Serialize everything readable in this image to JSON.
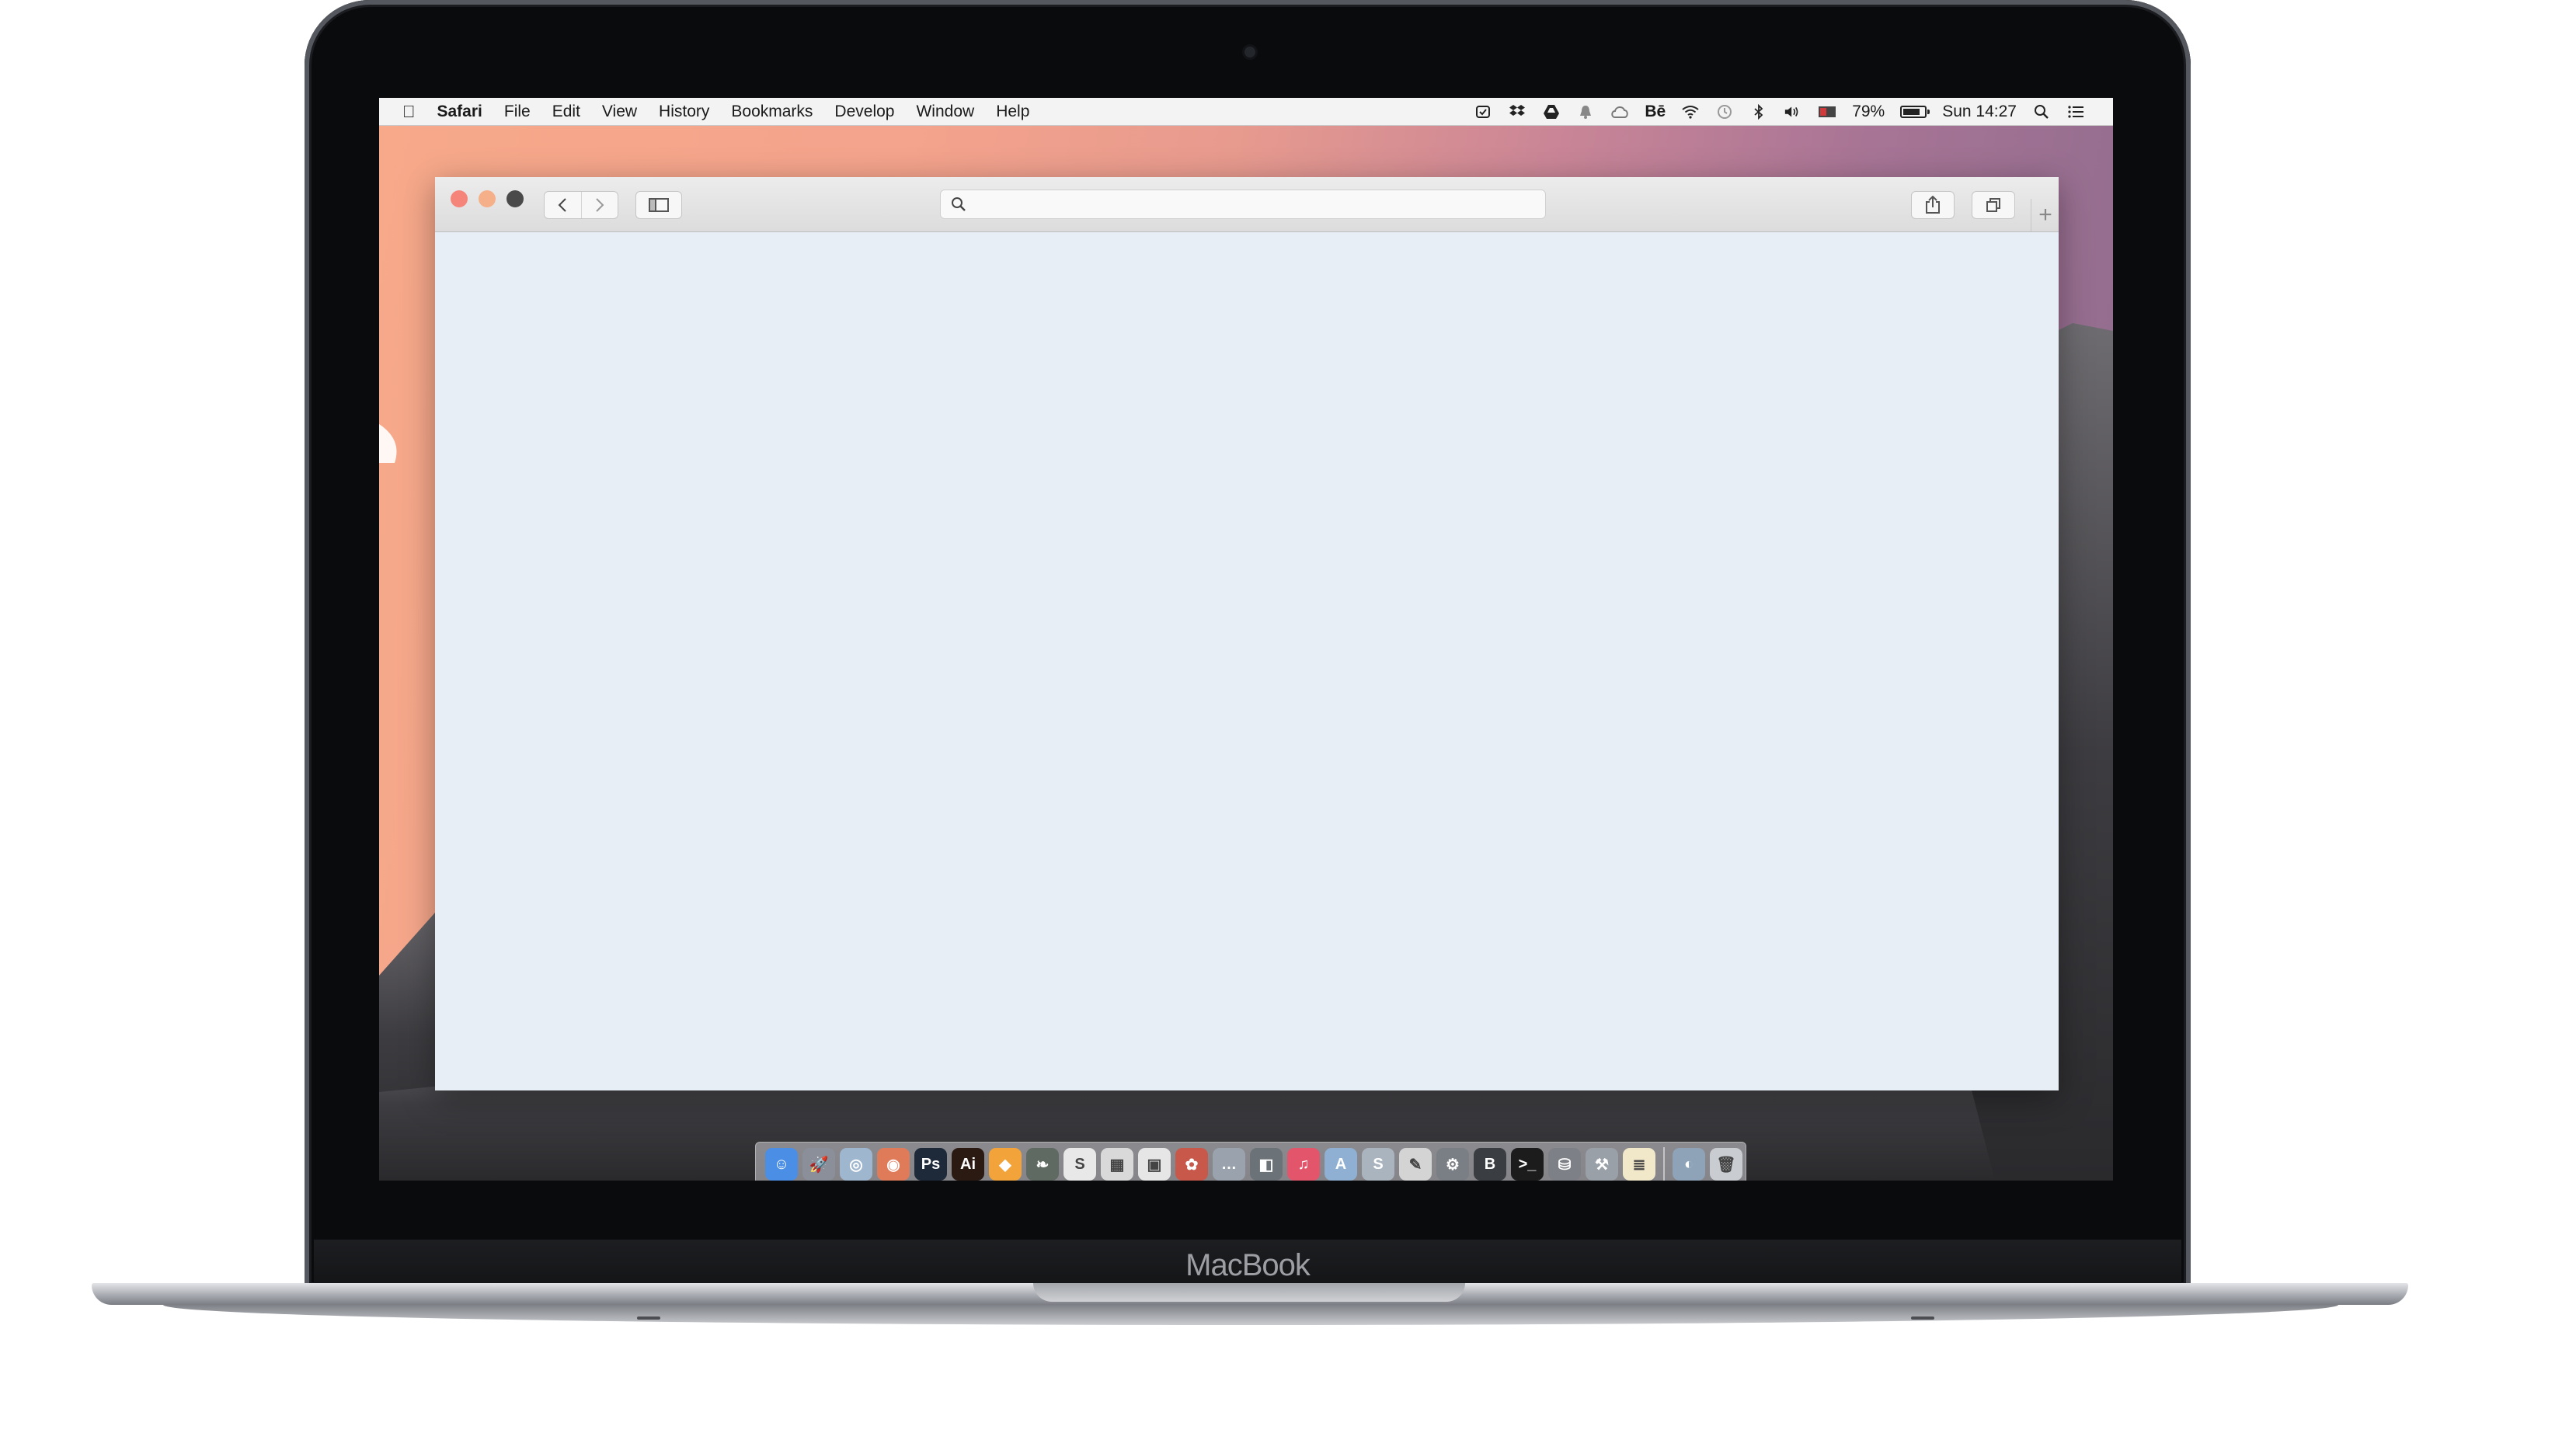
{
  "menubar": {
    "app_name": "Safari",
    "menus": [
      "File",
      "Edit",
      "View",
      "History",
      "Bookmarks",
      "Develop",
      "Window",
      "Help"
    ],
    "status": {
      "icons": [
        "checklist-icon",
        "dropbox-icon",
        "google-drive-icon",
        "bell-icon",
        "creative-cloud-icon"
      ],
      "behance_text": "Bē",
      "battery_percent_text": "79%",
      "battery_level": 0.79,
      "clock": "Sun 14:27"
    }
  },
  "laptop": {
    "brand_label": "MacBook"
  },
  "dock": {
    "apps": [
      {
        "name": "finder",
        "color": "#4a8ee6",
        "glyph": "☺"
      },
      {
        "name": "launchpad",
        "color": "#8a8f99",
        "glyph": "🚀"
      },
      {
        "name": "safari",
        "color": "#9fb6cf",
        "glyph": "◎"
      },
      {
        "name": "chrome",
        "color": "#e07b5a",
        "glyph": "◉"
      },
      {
        "name": "photoshop",
        "color": "#1e2a3a",
        "glyph": "Ps"
      },
      {
        "name": "illustrator",
        "color": "#2b1a12",
        "glyph": "Ai"
      },
      {
        "name": "sketch",
        "color": "#f2a33a",
        "glyph": "◆"
      },
      {
        "name": "messages-leaf",
        "color": "#5f6b62",
        "glyph": "❧"
      },
      {
        "name": "sublime",
        "color": "#e8e8e8",
        "glyph": "S"
      },
      {
        "name": "preview",
        "color": "#d9d9d9",
        "glyph": "▦"
      },
      {
        "name": "photos",
        "color": "#e6e6e6",
        "glyph": "▣"
      },
      {
        "name": "app-colorful",
        "color": "#c8584a",
        "glyph": "✿"
      },
      {
        "name": "chat-bubbles",
        "color": "#9aa3ad",
        "glyph": "…"
      },
      {
        "name": "facetime",
        "color": "#6b7278",
        "glyph": "◧"
      },
      {
        "name": "itunes",
        "color": "#e2556b",
        "glyph": "♫"
      },
      {
        "name": "app-store",
        "color": "#8fb0d2",
        "glyph": "A"
      },
      {
        "name": "skype",
        "color": "#aab4bf",
        "glyph": "S"
      },
      {
        "name": "textedit",
        "color": "#d4d4d4",
        "glyph": "✎"
      },
      {
        "name": "system-preferences",
        "color": "#7a7f86",
        "glyph": "⚙"
      },
      {
        "name": "bbedit",
        "color": "#3a3d42",
        "glyph": "B"
      },
      {
        "name": "terminal",
        "color": "#1c1c1c",
        "glyph": ">_"
      },
      {
        "name": "disk-utility",
        "color": "#7d8086",
        "glyph": "⛁"
      },
      {
        "name": "xcode-tools",
        "color": "#9aa0a8",
        "glyph": "⚒"
      },
      {
        "name": "notes",
        "color": "#f1e7c9",
        "glyph": "≣"
      }
    ],
    "trailing": [
      {
        "name": "downloads-globe",
        "color": "#8fa3b8",
        "glyph": "◐"
      },
      {
        "name": "trash",
        "color": "#c9ccd1",
        "glyph": "🗑"
      }
    ]
  }
}
